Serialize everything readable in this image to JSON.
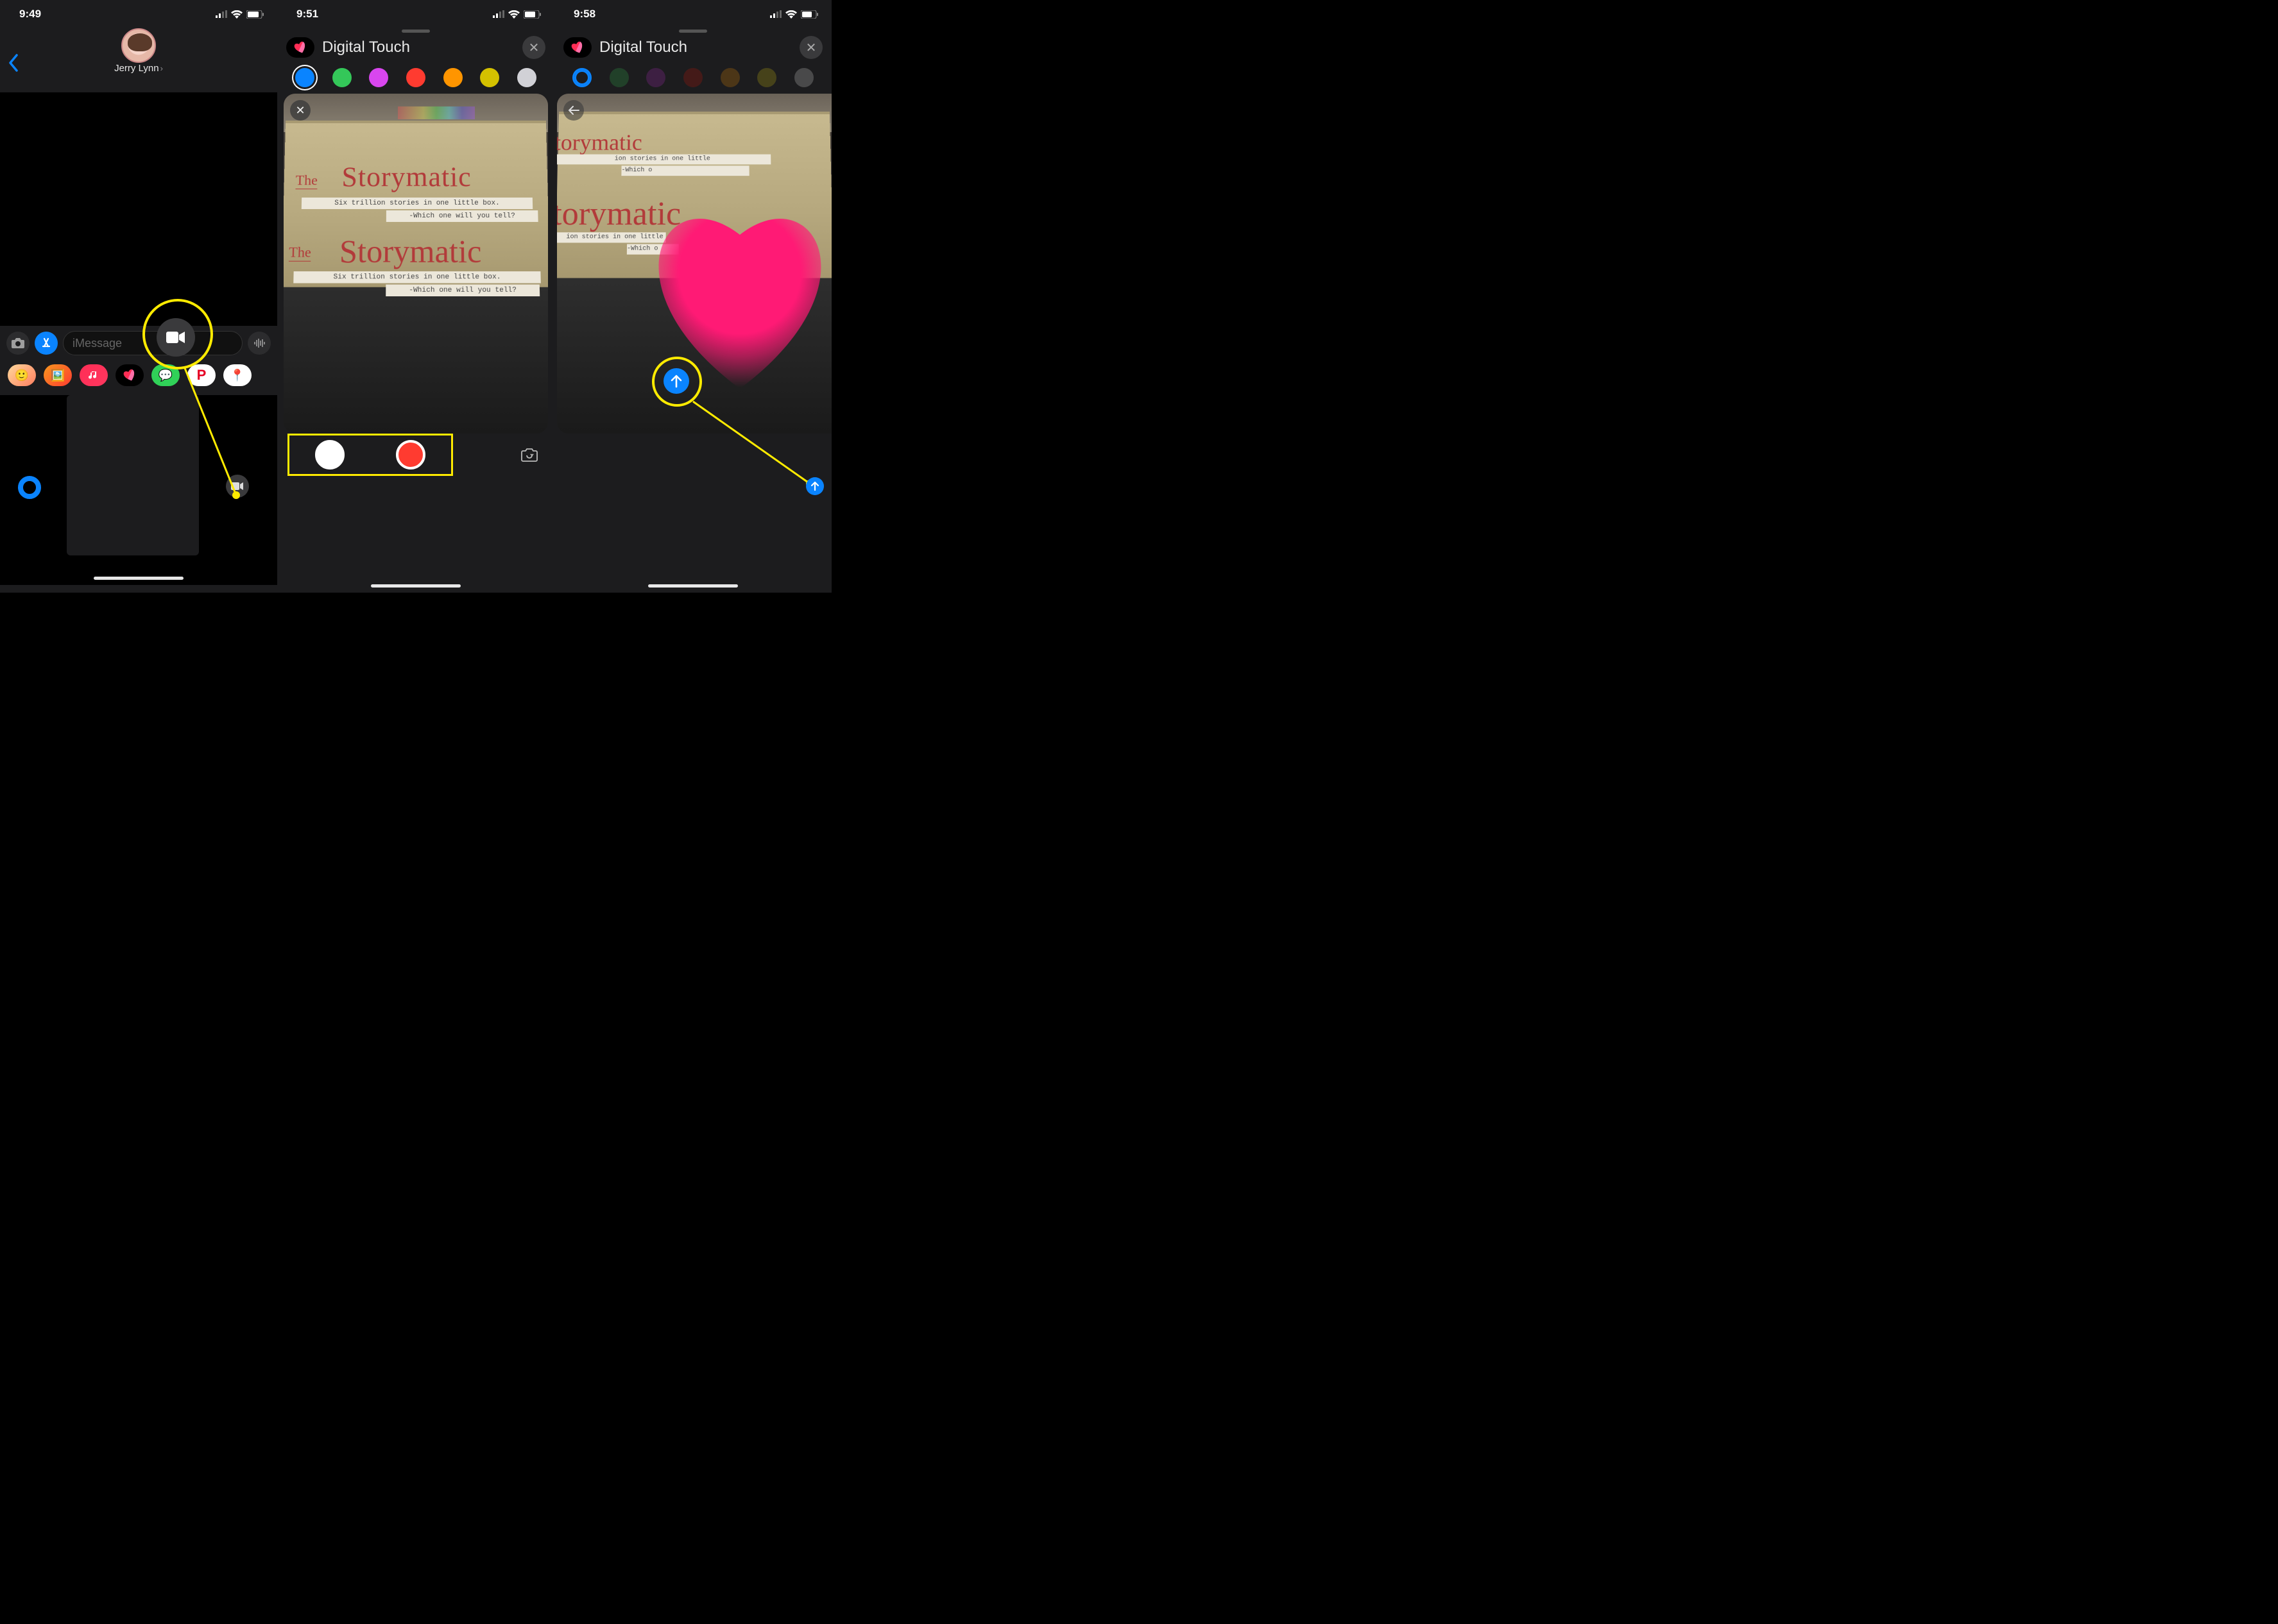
{
  "panel1": {
    "time": "9:49",
    "contact_name": "Jerry Lynn",
    "compose_placeholder": "iMessage"
  },
  "panel2": {
    "time": "9:51",
    "title": "Digital Touch",
    "colors": [
      "#0a84ff",
      "#34c759",
      "#d946ef",
      "#ff3b30",
      "#ff9500",
      "#d4c100",
      "#d1d1d6"
    ],
    "box_brand_prefix": "The",
    "box_brand": "Storymatic",
    "box_tagline": "Six trillion stories in one little box.",
    "box_prompt": "-Which one will you tell?"
  },
  "panel3": {
    "time": "9:58",
    "title": "Digital Touch",
    "box_brand": "torymatic",
    "box_tagline_frag": "ion stories in one little",
    "box_prompt_frag": "-Which o"
  }
}
